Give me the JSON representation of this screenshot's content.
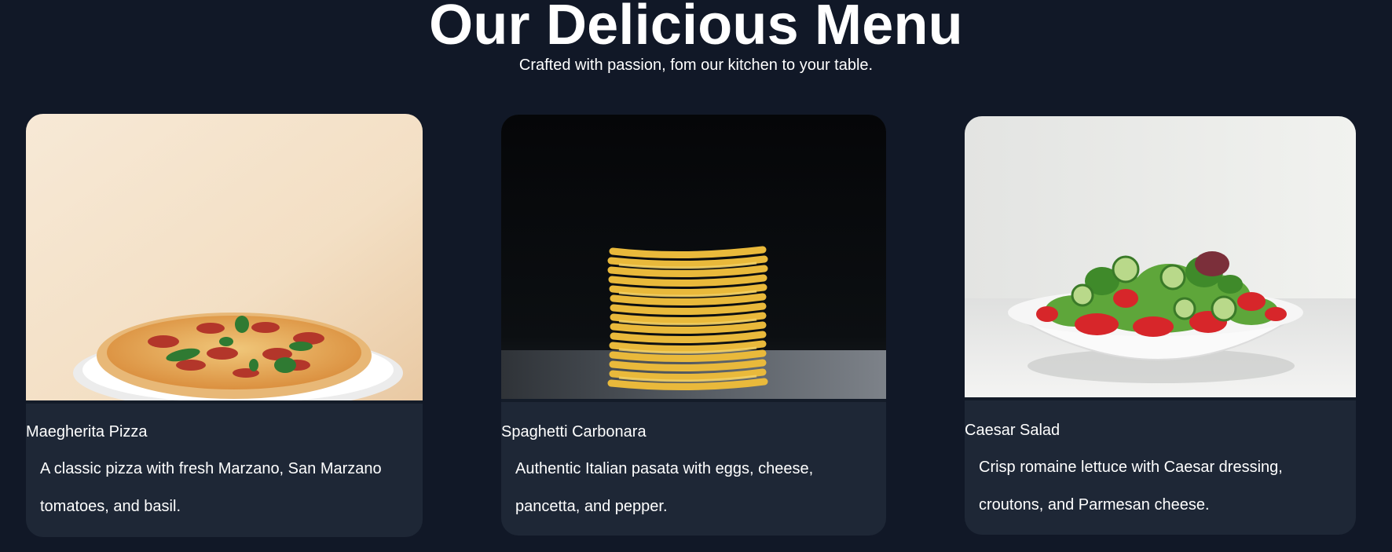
{
  "header": {
    "title": "Our Delicious Menu",
    "subtitle": "Crafted with passion, fom our kitchen to your table."
  },
  "menu": {
    "items": [
      {
        "name": "Maegherita Pizza",
        "description": "A classic pizza with fresh Marzano, San Marzano tomatoes, and basil.",
        "image_icon": "pizza-photo"
      },
      {
        "name": "Spaghetti Carbonara",
        "description": "Authentic Italian pasata with eggs, cheese, pancetta, and pepper.",
        "image_icon": "pasta-photo"
      },
      {
        "name": "Caesar Salad",
        "description": "Crisp romaine lettuce with Caesar dressing, croutons, and Parmesan cheese.",
        "image_icon": "salad-photo"
      }
    ]
  },
  "colors": {
    "background": "#111827",
    "card": "#1e2736",
    "text": "#ffffff"
  }
}
